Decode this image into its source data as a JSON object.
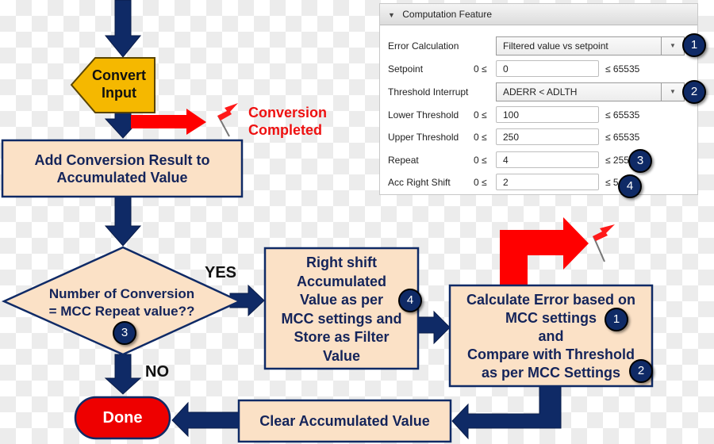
{
  "flowchart": {
    "convert_input": [
      "Convert",
      "Input"
    ],
    "conversion_completed": [
      "Conversion",
      "Completed"
    ],
    "add_result": [
      "Add Conversion Result to",
      "Accumulated Value"
    ],
    "decision": [
      "Number of Conversion",
      "= MCC Repeat value??"
    ],
    "yes_label": "YES",
    "no_label": "NO",
    "right_shift": [
      "Right shift",
      "Accumulated",
      "Value as per",
      "MCC settings and",
      "Store as Filter",
      "Value"
    ],
    "calculate_error": [
      "Calculate Error based on",
      "MCC settings",
      "and",
      "Compare with Threshold",
      "as per MCC Settings"
    ],
    "clear_accumulated": "Clear Accumulated Value",
    "done": "Done",
    "badges": [
      "1",
      "2",
      "3",
      "4"
    ],
    "colors": {
      "navy": "#0f2a66",
      "box_fill": "#fbe1c6",
      "red": "#ee0000",
      "yellow": "#f5b800"
    }
  },
  "panel": {
    "title": "Computation Feature",
    "collapse_icon": "triangle-down-icon",
    "rows": [
      {
        "label": "Error Calculation",
        "type": "dropdown",
        "value": "Filtered value vs setpoint",
        "badge": "1"
      },
      {
        "label": "Setpoint",
        "min": "0 ≤",
        "value": "0",
        "max": "≤ 65535"
      },
      {
        "label": "Threshold Interrupt",
        "type": "dropdown",
        "value": "ADERR < ADLTH",
        "badge": "2"
      },
      {
        "label": "Lower Threshold",
        "min": "0 ≤",
        "value": "100",
        "max": "≤ 65535"
      },
      {
        "label": "Upper Threshold",
        "min": "0 ≤",
        "value": "250",
        "max": "≤ 65535"
      },
      {
        "label": "Repeat",
        "min": "0 ≤",
        "value": "4",
        "max": "≤ 255",
        "badge": "3"
      },
      {
        "label": "Acc Right Shift",
        "min": "0 ≤",
        "value": "2",
        "max": "≤ 5",
        "badge": "4"
      }
    ]
  }
}
